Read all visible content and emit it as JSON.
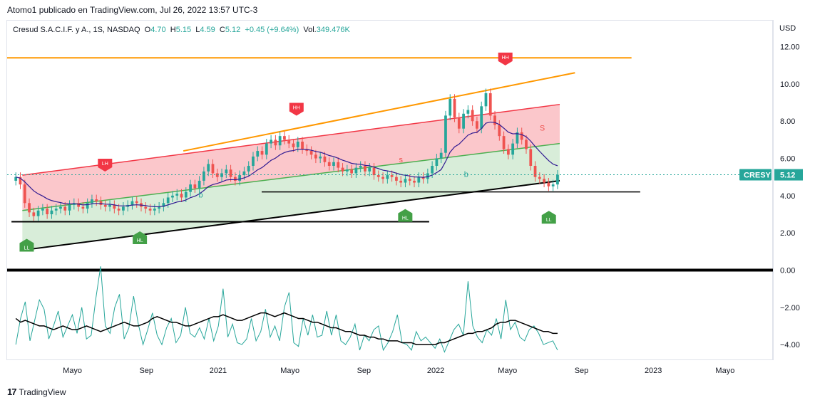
{
  "header": {
    "publisher": "Atomo1 publicado en TradingView.com, Jul 26, 2022 13:57 UTC-3"
  },
  "legend": {
    "symbol": "Cresud S.A.C.I.F. y A., 1S, NASDAQ",
    "open_label": "O",
    "open": "4.70",
    "high_label": "H",
    "high": "5.15",
    "low_label": "L",
    "low": "4.59",
    "close_label": "C",
    "close": "5.12",
    "change": "+0.45 (+9.64%)",
    "vol_label": "Vol.",
    "vol": "349.476K"
  },
  "currency": "USD",
  "ticker_badge": {
    "symbol": "CRESY",
    "price": "5.12"
  },
  "footer": {
    "brand": "TradingView"
  },
  "colors": {
    "up": "#26a69a",
    "down": "#ef5350",
    "upper_line": "#f23645",
    "mid_line": "#4caf50",
    "orange": "#ff9800",
    "ema": "#311b92"
  },
  "chart_data": {
    "type": "candlestick",
    "ylim": [
      -4.8,
      13.4
    ],
    "y_ticks": [
      12.0,
      10.0,
      8.0,
      6.0,
      4.0,
      2.0,
      0.0,
      -2.0,
      -4.0
    ],
    "y_tick_labels": [
      "12.00",
      "10.00",
      "8.00",
      "6.00",
      "4.00",
      "2.00",
      "0.00",
      "−2.00",
      "−4.00"
    ],
    "x_ticks": [
      {
        "label": "Mayo",
        "t": 2020.33
      },
      {
        "label": "Sep",
        "t": 2020.67
      },
      {
        "label": "2021",
        "t": 2021.0
      },
      {
        "label": "Mayo",
        "t": 2021.33
      },
      {
        "label": "Sep",
        "t": 2021.67
      },
      {
        "label": "2022",
        "t": 2022.0
      },
      {
        "label": "Mayo",
        "t": 2022.33
      },
      {
        "label": "Sep",
        "t": 2022.67
      },
      {
        "label": "2023",
        "t": 2023.0
      },
      {
        "label": "Mayo",
        "t": 2023.33
      }
    ],
    "xlim": [
      2020.03,
      2023.55
    ],
    "weekly_closes": [
      5.0,
      4.6,
      3.6,
      3.1,
      2.9,
      3.2,
      3.3,
      3.0,
      3.2,
      3.3,
      3.4,
      3.2,
      3.5,
      3.6,
      3.4,
      3.3,
      3.6,
      3.8,
      3.7,
      3.5,
      3.4,
      3.5,
      3.3,
      3.2,
      3.4,
      3.5,
      3.7,
      3.6,
      3.4,
      3.3,
      3.2,
      3.3,
      3.4,
      3.6,
      3.9,
      4.0,
      4.1,
      3.9,
      4.2,
      4.6,
      4.4,
      4.8,
      5.3,
      5.7,
      5.2,
      5.0,
      5.2,
      5.4,
      5.0,
      4.8,
      5.1,
      5.3,
      5.6,
      6.1,
      6.4,
      6.2,
      6.8,
      7.0,
      6.7,
      7.2,
      7.0,
      6.8,
      6.6,
      6.9,
      6.5,
      6.4,
      6.2,
      6.0,
      6.1,
      5.8,
      5.6,
      5.8,
      5.5,
      5.3,
      5.4,
      5.2,
      5.5,
      5.6,
      5.3,
      5.5,
      5.1,
      5.0,
      4.9,
      5.1,
      5.0,
      4.8,
      4.7,
      4.9,
      4.8,
      4.7,
      5.0,
      4.9,
      5.2,
      5.6,
      6.0,
      6.3,
      8.3,
      9.2,
      8.2,
      7.6,
      8.4,
      8.6,
      8.0,
      7.6,
      8.8,
      9.5,
      8.3,
      7.8,
      7.2,
      6.5,
      6.2,
      6.8,
      7.4,
      7.0,
      6.5,
      5.6,
      5.0,
      4.9,
      4.7,
      4.5,
      4.6,
      5.12
    ],
    "series": [
      {
        "name": "OscillatorSlow"
      },
      {
        "name": "OscillatorFast"
      }
    ],
    "levels": {
      "orange_horizontal": 11.4,
      "support_upper": 4.2,
      "support_lower": 2.6,
      "zero_line": 0.0
    },
    "channel": {
      "start_t": 2020.1,
      "end_t": 2022.57,
      "upper_start": 5.1,
      "upper_end": 8.9,
      "mid_start": 3.2,
      "mid_end": 6.8,
      "lower_start": 1.1,
      "lower_end": 4.8
    },
    "orange_trendline": {
      "start_t": 2020.84,
      "start_v": 6.4,
      "end_t": 2022.64,
      "end_v": 10.6
    },
    "labels": [
      {
        "text": "LL",
        "kind": "low",
        "t": 2020.12,
        "v": 1.3
      },
      {
        "text": "LH",
        "kind": "high",
        "t": 2020.48,
        "v": 5.6
      },
      {
        "text": "HL",
        "kind": "low",
        "t": 2020.64,
        "v": 1.7
      },
      {
        "text": "HH",
        "kind": "high",
        "t": 2021.36,
        "v": 8.6
      },
      {
        "text": "HL",
        "kind": "low",
        "t": 2021.86,
        "v": 2.9
      },
      {
        "text": "HH",
        "kind": "high",
        "t": 2022.32,
        "v": 11.3
      },
      {
        "text": "LL",
        "kind": "low",
        "t": 2022.52,
        "v": 2.8
      }
    ],
    "signals": [
      {
        "text": "b",
        "t": 2020.92,
        "v": 3.9
      },
      {
        "text": "s",
        "t": 2021.84,
        "v": 5.8
      },
      {
        "text": "b",
        "t": 2022.14,
        "v": 5.0
      },
      {
        "text": "S",
        "t": 2022.49,
        "v": 7.5
      }
    ],
    "osc_slow": [
      -2.6,
      -2.8,
      -2.7,
      -2.8,
      -2.9,
      -3.0,
      -3.0,
      -3.1,
      -3.2,
      -3.1,
      -3.0,
      -3.1,
      -3.2,
      -3.2,
      -3.1,
      -3.0,
      -3.1,
      -3.2,
      -3.3,
      -3.2,
      -3.1,
      -3.0,
      -2.9,
      -2.8,
      -2.9,
      -3.0,
      -3.0,
      -2.9,
      -2.8,
      -2.6,
      -2.5,
      -2.6,
      -2.7,
      -2.8,
      -2.8,
      -2.9,
      -3.0,
      -3.0,
      -2.9,
      -2.8,
      -2.7,
      -2.6,
      -2.5,
      -2.5,
      -2.4,
      -2.5,
      -2.6,
      -2.7,
      -2.7,
      -2.6,
      -2.5,
      -2.4,
      -2.3,
      -2.3,
      -2.4,
      -2.5,
      -2.4,
      -2.3,
      -2.4,
      -2.5,
      -2.6,
      -2.6,
      -2.7,
      -2.8,
      -2.8,
      -2.9,
      -3.0,
      -3.1,
      -3.1,
      -3.2,
      -3.3,
      -3.3,
      -3.4,
      -3.5,
      -3.5,
      -3.6,
      -3.6,
      -3.7,
      -3.7,
      -3.8,
      -3.8,
      -3.8,
      -3.9,
      -3.9,
      -3.9,
      -4.0,
      -4.0,
      -4.0,
      -4.0,
      -4.0,
      -3.9,
      -3.9,
      -3.8,
      -3.7,
      -3.6,
      -3.5,
      -3.4,
      -3.4,
      -3.3,
      -3.3,
      -3.2,
      -3.1,
      -2.9,
      -2.8,
      -2.8,
      -2.7,
      -2.7,
      -2.8,
      -2.9,
      -3.0,
      -3.1,
      -3.2,
      -3.3,
      -3.3,
      -3.4,
      -3.4
    ],
    "osc_fast": [
      -4.0,
      -2.6,
      -1.7,
      -3.8,
      -2.7,
      -1.6,
      -2.1,
      -3.7,
      -3.0,
      -2.2,
      -3.6,
      -3.0,
      -2.4,
      -3.4,
      -2.0,
      -3.7,
      -3.5,
      -1.5,
      0.2,
      -3.0,
      -3.4,
      -2.0,
      -1.3,
      -3.7,
      -3.1,
      -1.4,
      -2.9,
      -4.0,
      -3.2,
      -2.3,
      -3.5,
      -4.0,
      -3.1,
      -2.6,
      -3.9,
      -3.5,
      -2.0,
      -3.4,
      -3.6,
      -3.1,
      -3.7,
      -2.6,
      -3.8,
      -3.0,
      -1.0,
      -3.6,
      -2.9,
      -3.9,
      -4.0,
      -3.7,
      -2.6,
      -3.8,
      -3.3,
      -2.1,
      -3.6,
      -3.0,
      -3.8,
      -2.0,
      -1.2,
      -3.9,
      -4.1,
      -2.6,
      -3.5,
      -2.4,
      -3.6,
      -3.5,
      -2.2,
      -3.5,
      -2.4,
      -3.8,
      -4.0,
      -3.6,
      -2.9,
      -4.3,
      -3.5,
      -3.8,
      -3.2,
      -3.0,
      -4.3,
      -3.9,
      -3.3,
      -2.4,
      -3.9,
      -4.0,
      -4.3,
      -3.3,
      -3.8,
      -3.6,
      -3.9,
      -4.2,
      -3.7,
      -4.4,
      -3.8,
      -3.2,
      -2.9,
      -3.5,
      -0.6,
      -3.0,
      -3.6,
      -3.9,
      -3.2,
      -3.5,
      -2.6,
      -3.7,
      -1.6,
      -3.2,
      -2.8,
      -3.6,
      -3.8,
      -3.2,
      -3.0,
      -3.4,
      -4.0,
      -3.9,
      -3.8,
      -4.3
    ]
  }
}
